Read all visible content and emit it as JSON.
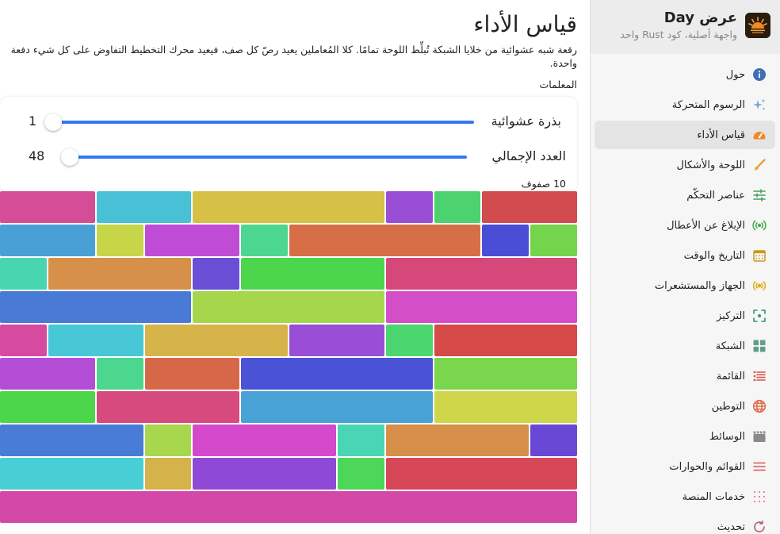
{
  "sidebar": {
    "title": "عرض Day",
    "subtitle": "واجهة أصلية، كود Rust واحد",
    "items": [
      {
        "label": "حول",
        "icon": "info-icon",
        "color": "#3d6fb6",
        "name": "about"
      },
      {
        "label": "الرسوم المتحركة",
        "icon": "sparkles-icon",
        "color": "#6fa8dc",
        "name": "animations"
      },
      {
        "label": "قياس الأداء",
        "icon": "gauge-icon",
        "color": "#f08a24",
        "name": "performance",
        "active": true
      },
      {
        "label": "اللوحة والأشكال",
        "icon": "brush-icon",
        "color": "#e8a13a",
        "name": "canvas-shapes"
      },
      {
        "label": "عناصر التحكّم",
        "icon": "sliders-icon",
        "color": "#4a9e5c",
        "name": "controls"
      },
      {
        "label": "الإبلاغ عن الأعطال",
        "icon": "broadcast-icon",
        "color": "#4caf50",
        "name": "crash-reporting"
      },
      {
        "label": "التاريخ والوقت",
        "icon": "calendar-icon",
        "color": "#c89b1e",
        "name": "date-time"
      },
      {
        "label": "الجهاز والمستشعرات",
        "icon": "sensor-icon",
        "color": "#e0b020",
        "name": "device-sensors"
      },
      {
        "label": "التركيز",
        "icon": "focus-icon",
        "color": "#3a8f7a",
        "name": "focus"
      },
      {
        "label": "الشبكة",
        "icon": "grid-icon",
        "color": "#5f9e8a",
        "name": "grid"
      },
      {
        "label": "القائمة",
        "icon": "list-icon",
        "color": "#d9534f",
        "name": "list"
      },
      {
        "label": "التوطين",
        "icon": "globe-icon",
        "color": "#e07050",
        "name": "localization"
      },
      {
        "label": "الوسائط",
        "icon": "clapper-icon",
        "color": "#8a8a8a",
        "name": "media"
      },
      {
        "label": "القوائم والحوارات",
        "icon": "menu-icon",
        "color": "#d9534f",
        "name": "menus-dialogs"
      },
      {
        "label": "خدمات المنصة",
        "icon": "dots-grid-icon",
        "color": "#e08090",
        "name": "platform-services"
      },
      {
        "label": "تحديث",
        "icon": "refresh-icon",
        "color": "#b05a7a",
        "name": "refresh"
      }
    ]
  },
  "main": {
    "title": "قياس الأداء",
    "description": "رقعة شبه عشوائية من خلايا الشبكة تُبلِّط اللوحة تمامًا. كلا المُعاملين يعيد رصّ كل صف، فيعيد محرك التخطيط التفاوض على كل شيء دفعة واحدة.",
    "params_label": "المعلمات",
    "seed": {
      "label": "بذرة عشوائية",
      "value": "1",
      "level": 1.0
    },
    "total": {
      "label": "العدد الإجمالي",
      "value": "48",
      "level": 0.98
    },
    "rows_label": "10 صفوف"
  },
  "colors": {
    "accent": "#3478f6",
    "active_item_bg": "#e4e4e4"
  },
  "tiles": [
    {
      "row": 0,
      "col": 0,
      "span": 2,
      "color": "#d24b4f"
    },
    {
      "row": 0,
      "col": 2,
      "span": 1,
      "color": "#4cd26e"
    },
    {
      "row": 0,
      "col": 3,
      "span": 1,
      "color": "#9a4ed6"
    },
    {
      "row": 0,
      "col": 4,
      "span": 4,
      "color": "#d6c045"
    },
    {
      "row": 0,
      "col": 8,
      "span": 2,
      "color": "#48c0d6"
    },
    {
      "row": 0,
      "col": 10,
      "span": 2,
      "color": "#d44d96"
    },
    {
      "row": 1,
      "col": 0,
      "span": 1,
      "color": "#74d44c"
    },
    {
      "row": 1,
      "col": 1,
      "span": 1,
      "color": "#4a4ed6"
    },
    {
      "row": 1,
      "col": 2,
      "span": 4,
      "color": "#d66f48"
    },
    {
      "row": 1,
      "col": 6,
      "span": 1,
      "color": "#4cd690"
    },
    {
      "row": 1,
      "col": 7,
      "span": 2,
      "color": "#c04cd6"
    },
    {
      "row": 1,
      "col": 9,
      "span": 1,
      "color": "#c6d648"
    },
    {
      "row": 1,
      "col": 10,
      "span": 2,
      "color": "#48a0d6"
    },
    {
      "row": 2,
      "col": 0,
      "span": 4,
      "color": "#d6487a"
    },
    {
      "row": 2,
      "col": 4,
      "span": 3,
      "color": "#4cd64c"
    },
    {
      "row": 2,
      "col": 7,
      "span": 1,
      "color": "#6a4ed6"
    },
    {
      "row": 2,
      "col": 8,
      "span": 3,
      "color": "#d6904a"
    },
    {
      "row": 2,
      "col": 11,
      "span": 1,
      "color": "#48d6b0"
    },
    {
      "row": 3,
      "col": 0,
      "span": 4,
      "color": "#d44ec8"
    },
    {
      "row": 3,
      "col": 4,
      "span": 4,
      "color": "#a6d64c"
    },
    {
      "row": 3,
      "col": 8,
      "span": 4,
      "color": "#487ad6"
    },
    {
      "row": 4,
      "col": 0,
      "span": 3,
      "color": "#d64a4a"
    },
    {
      "row": 4,
      "col": 3,
      "span": 1,
      "color": "#4cd670"
    },
    {
      "row": 4,
      "col": 4,
      "span": 2,
      "color": "#9a4ed6"
    },
    {
      "row": 4,
      "col": 6,
      "span": 3,
      "color": "#d6b44a"
    },
    {
      "row": 4,
      "col": 9,
      "span": 2,
      "color": "#48c8d6"
    },
    {
      "row": 4,
      "col": 11,
      "span": 1,
      "color": "#d64aa0"
    },
    {
      "row": 5,
      "col": 0,
      "span": 3,
      "color": "#7ad64c"
    },
    {
      "row": 5,
      "col": 3,
      "span": 4,
      "color": "#4a52d6"
    },
    {
      "row": 5,
      "col": 7,
      "span": 2,
      "color": "#d66848"
    },
    {
      "row": 5,
      "col": 9,
      "span": 1,
      "color": "#4cd68e"
    },
    {
      "row": 5,
      "col": 10,
      "span": 2,
      "color": "#b44ed6"
    },
    {
      "row": 6,
      "col": 0,
      "span": 3,
      "color": "#cfd64a"
    },
    {
      "row": 6,
      "col": 3,
      "span": 4,
      "color": "#48a2d6"
    },
    {
      "row": 6,
      "col": 7,
      "span": 3,
      "color": "#d64a7e"
    },
    {
      "row": 6,
      "col": 10,
      "span": 2,
      "color": "#4cd64a"
    },
    {
      "row": 7,
      "col": 0,
      "span": 1,
      "color": "#6a48d6"
    },
    {
      "row": 7,
      "col": 1,
      "span": 3,
      "color": "#d68e48"
    },
    {
      "row": 7,
      "col": 4,
      "span": 1,
      "color": "#48d6b4"
    },
    {
      "row": 7,
      "col": 5,
      "span": 3,
      "color": "#d448cc"
    },
    {
      "row": 7,
      "col": 8,
      "span": 1,
      "color": "#a8d64c"
    },
    {
      "row": 7,
      "col": 9,
      "span": 3,
      "color": "#487cd6"
    },
    {
      "row": 8,
      "col": 0,
      "span": 4,
      "color": "#d64858"
    },
    {
      "row": 8,
      "col": 4,
      "span": 1,
      "color": "#4cd65a"
    },
    {
      "row": 8,
      "col": 5,
      "span": 3,
      "color": "#8e4ad6"
    },
    {
      "row": 8,
      "col": 8,
      "span": 1,
      "color": "#d6b24a"
    },
    {
      "row": 8,
      "col": 9,
      "span": 3,
      "color": "#48cfd6"
    },
    {
      "row": 9,
      "col": 0,
      "span": 12,
      "color": "#d448a8"
    }
  ]
}
